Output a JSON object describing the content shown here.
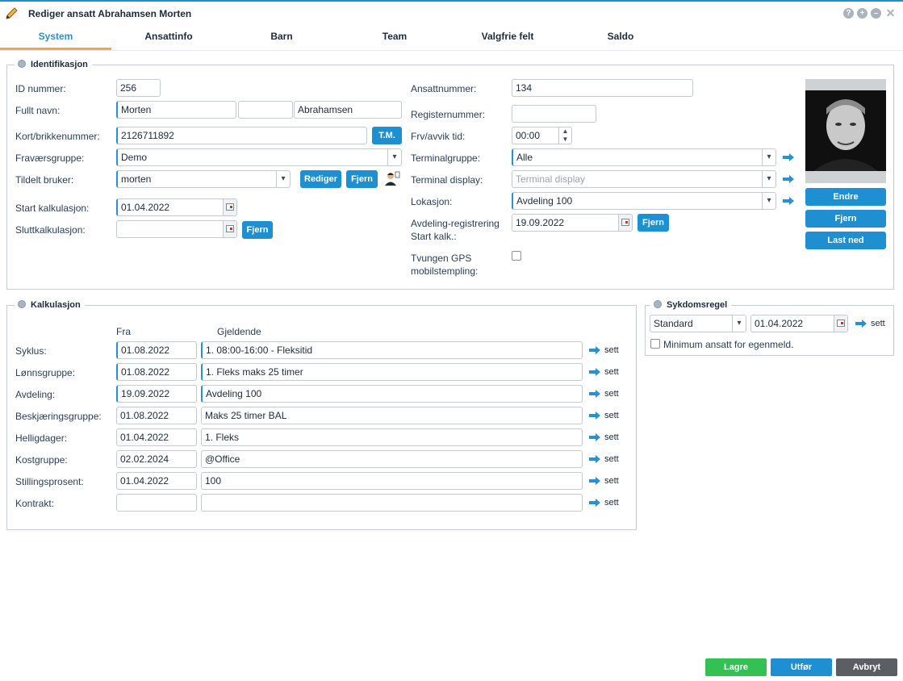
{
  "window": {
    "title": "Rediger ansatt Abrahamsen Morten"
  },
  "tabs": [
    "System",
    "Ansattinfo",
    "Barn",
    "Team",
    "Valgfrie felt",
    "Saldo"
  ],
  "identifikasjon": {
    "legend": "Identifikasjon",
    "id_label": "ID nummer:",
    "id_value": "256",
    "fullname_label": "Fullt navn:",
    "first_name": "Morten",
    "middle_name": "",
    "last_name": "Abrahamsen",
    "card_label": "Kort/brikkenummer:",
    "card_value": "2126711892",
    "tm_button": "T.M.",
    "absence_group_label": "Fraværsgruppe:",
    "absence_group_value": "Demo",
    "user_label": "Tildelt bruker:",
    "user_value": "morten",
    "edit_button": "Rediger",
    "remove_button": "Fjern",
    "start_calc_label": "Start kalkulasjon:",
    "start_calc_value": "01.04.2022",
    "end_calc_label": "Sluttkalkulasjon:",
    "end_calc_value": "",
    "end_remove_button": "Fjern",
    "emp_no_label": "Ansattnummer:",
    "emp_no_value": "134",
    "reg_no_label": "Registernummer:",
    "reg_no_value": "",
    "frv_label": "Frv/avvik tid:",
    "frv_value": "00:00",
    "terminal_group_label": "Terminalgruppe:",
    "terminal_group_value": "Alle",
    "terminal_display_label": "Terminal display:",
    "terminal_display_placeholder": "Terminal display",
    "location_label": "Lokasjon:",
    "location_value": "Avdeling 100",
    "dept_reg_label_1": "Avdeling-registrering",
    "dept_reg_label_2": "Start kalk.:",
    "dept_reg_value": "19.09.2022",
    "dept_reg_remove": "Fjern",
    "gps_label_1": "Tvungen GPS",
    "gps_label_2": "mobilstempling:",
    "photo_buttons": [
      "Endre",
      "Fjern",
      "Last ned"
    ]
  },
  "kalkulasjon": {
    "legend": "Kalkulasjon",
    "col_from": "Fra",
    "col_current": "Gjeldende",
    "rows": [
      {
        "label": "Syklus:",
        "from": "01.08.2022",
        "current": "1. 08:00-16:00 - Fleksitid"
      },
      {
        "label": "Lønnsgruppe:",
        "from": "01.08.2022",
        "current": "1. Fleks maks 25 timer"
      },
      {
        "label": "Avdeling:",
        "from": "19.09.2022",
        "current": "Avdeling 100"
      },
      {
        "label": "Beskjæringsgruppe:",
        "from": "01.08.2022",
        "current": "Maks 25 timer BAL"
      },
      {
        "label": "Helligdager:",
        "from": "01.04.2022",
        "current": "1. Fleks"
      },
      {
        "label": "Kostgruppe:",
        "from": "02.02.2024",
        "current": "@Office"
      },
      {
        "label": "Stillingsprosent:",
        "from": "01.04.2022",
        "current": "100"
      },
      {
        "label": "Kontrakt:",
        "from": "",
        "current": ""
      }
    ],
    "set_label": "sett"
  },
  "sykdomsregel": {
    "legend": "Sykdomsregel",
    "rule_value": "Standard",
    "date_value": "01.04.2022",
    "set_label": "sett",
    "min_label": "Minimum ansatt for egenmeld."
  },
  "footer": {
    "save": "Lagre",
    "execute": "Utfør",
    "cancel": "Avbryt"
  },
  "colors": {
    "accent": "#1e8fd0",
    "save": "#33c153",
    "cancel": "#5b5f63",
    "tab_active": "#2b8fd3",
    "tab_underline": "#f2a73b"
  }
}
